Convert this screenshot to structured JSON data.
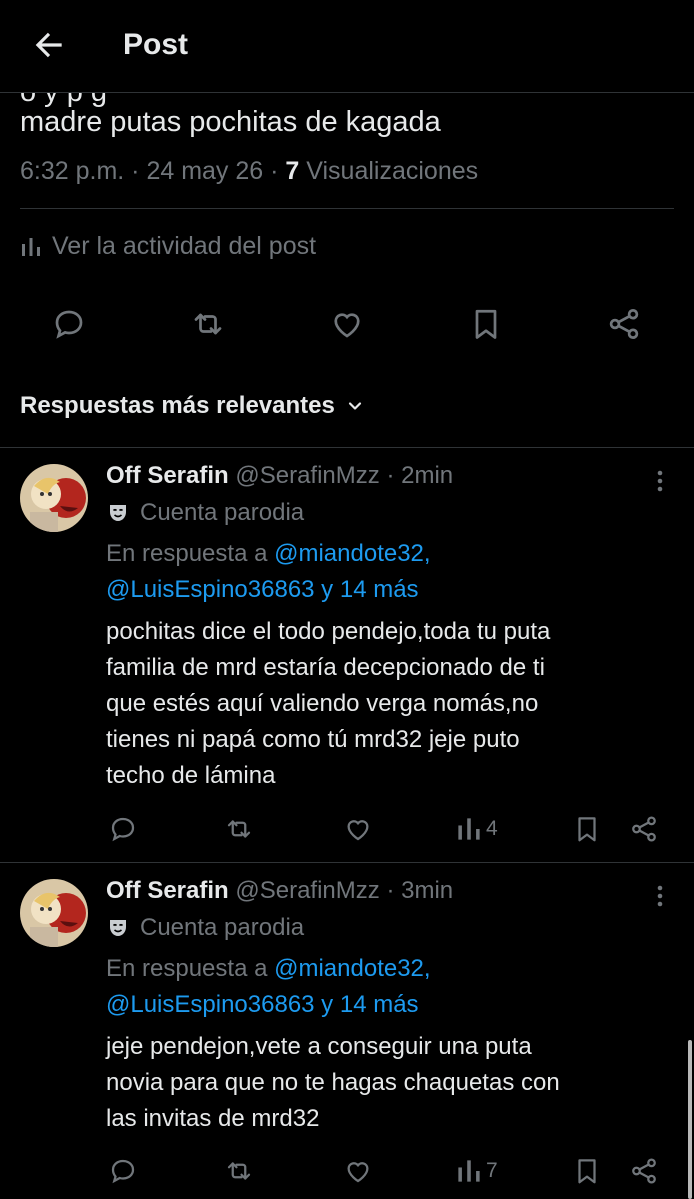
{
  "header": {
    "title": "Post"
  },
  "post": {
    "text_partial_line": "o           y          p                                                 g",
    "text_last_line": "madre putas pochitas de kagada",
    "time": "6:32 p.m.",
    "date": "24 may 26",
    "views_count": "7",
    "views_label": "Visualizaciones",
    "activity_label": "Ver la actividad del post"
  },
  "sort": {
    "label": "Respuestas más relevantes"
  },
  "replies": [
    {
      "name": "Off Serafin",
      "handle": "@SerafinMzz",
      "time": "2min",
      "parody_label": "Cuenta parodia",
      "reply_prefix": "En respuesta a",
      "reply_mention_1": "@miandote32,",
      "reply_mention_2": "@LuisEspino36863 y 14 más",
      "body_lines": [
        "pochitas dice el todo pendejo,toda tu puta",
        "familia de mrd estaría decepcionado de ti",
        "que estés aquí valiendo verga nomás,no",
        "tienes ni papá como tú mrd32 jeje puto",
        "techo de lámina"
      ],
      "views": "4"
    },
    {
      "name": "Off Serafin",
      "handle": "@SerafinMzz",
      "time": "3min",
      "parody_label": "Cuenta parodia",
      "reply_prefix": "En respuesta a",
      "reply_mention_1": "@miandote32,",
      "reply_mention_2": "@LuisEspino36863 y 14 más",
      "body_lines": [
        "jeje pendejon,vete a conseguir una puta",
        "novia para que no te hagas chaquetas con",
        "las invitas de mrd32"
      ],
      "views": "7"
    }
  ],
  "colors": {
    "background": "#000000",
    "text": "#e7e9ea",
    "muted": "#71767b",
    "link": "#1d9bf0",
    "divider": "#2f3336"
  },
  "icons": [
    "back-arrow-icon",
    "chart-icon",
    "reply-icon",
    "retweet-icon",
    "like-icon",
    "bookmark-icon",
    "share-icon",
    "more-icon",
    "mask-icon",
    "chevron-down-icon"
  ]
}
